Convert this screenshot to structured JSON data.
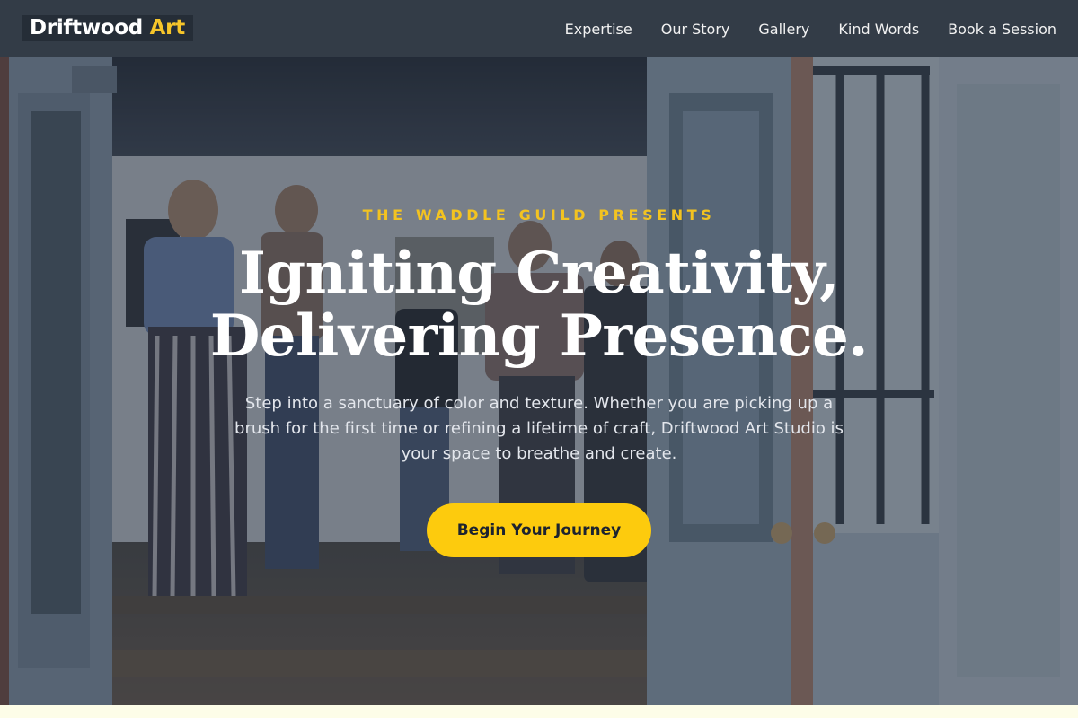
{
  "brand": {
    "name": "Driftwood",
    "accent": "Art"
  },
  "nav": {
    "items": [
      "Expertise",
      "Our Story",
      "Gallery",
      "Kind Words",
      "Book a Session"
    ]
  },
  "hero": {
    "eyebrow": "THE WADDLE GUILD PRESENTS",
    "headline_line1": "Igniting Creativity,",
    "headline_line2": "Delivering Presence.",
    "subtext": "Step into a sanctuary of color and texture. Whether you are picking up a brush for the first time or refining a lifetime of craft, Driftwood Art Studio is your space to breathe and create.",
    "cta": "Begin Your Journey"
  },
  "colors": {
    "navbar_bg": "#333c47",
    "brand_accent": "#f6c52a",
    "eyebrow": "#f3c320",
    "cta_bg": "#fdcb0d",
    "cta_text": "#1c2330"
  }
}
